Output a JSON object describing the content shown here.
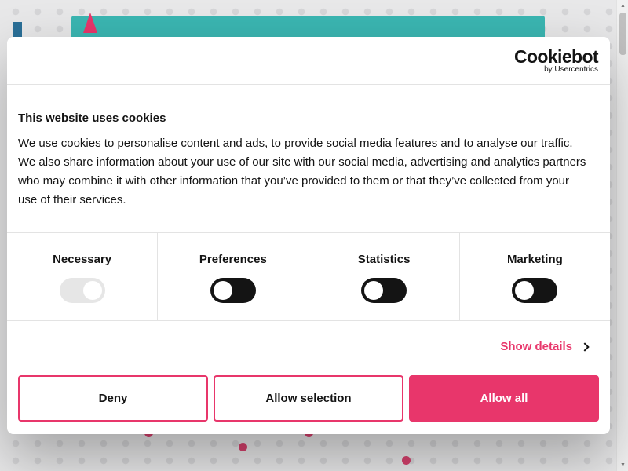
{
  "dialog": {
    "brand": {
      "name": "Cookiebot",
      "sub": "by Usercentrics"
    },
    "title": "This website uses cookies",
    "text": "We use cookies to personalise content and ads, to provide social media features and to analyse our traffic. We also share information about your use of our site with our social media, advertising and analytics partners who may combine it with other information that you’ve provided to them or that they’ve collected from your use of their services.",
    "categories": [
      {
        "label": "Necessary",
        "checked": true,
        "disabled": true
      },
      {
        "label": "Preferences",
        "checked": false,
        "disabled": false
      },
      {
        "label": "Statistics",
        "checked": false,
        "disabled": false
      },
      {
        "label": "Marketing",
        "checked": false,
        "disabled": false
      }
    ],
    "show_details": "Show details",
    "buttons": {
      "deny": "Deny",
      "allow_selection": "Allow selection",
      "allow_all": "Allow all"
    }
  },
  "colors": {
    "accent": "#e8366b",
    "text": "#141414",
    "hero": "#3bb6b2"
  },
  "icons": {
    "details": "chevron-right-icon"
  }
}
